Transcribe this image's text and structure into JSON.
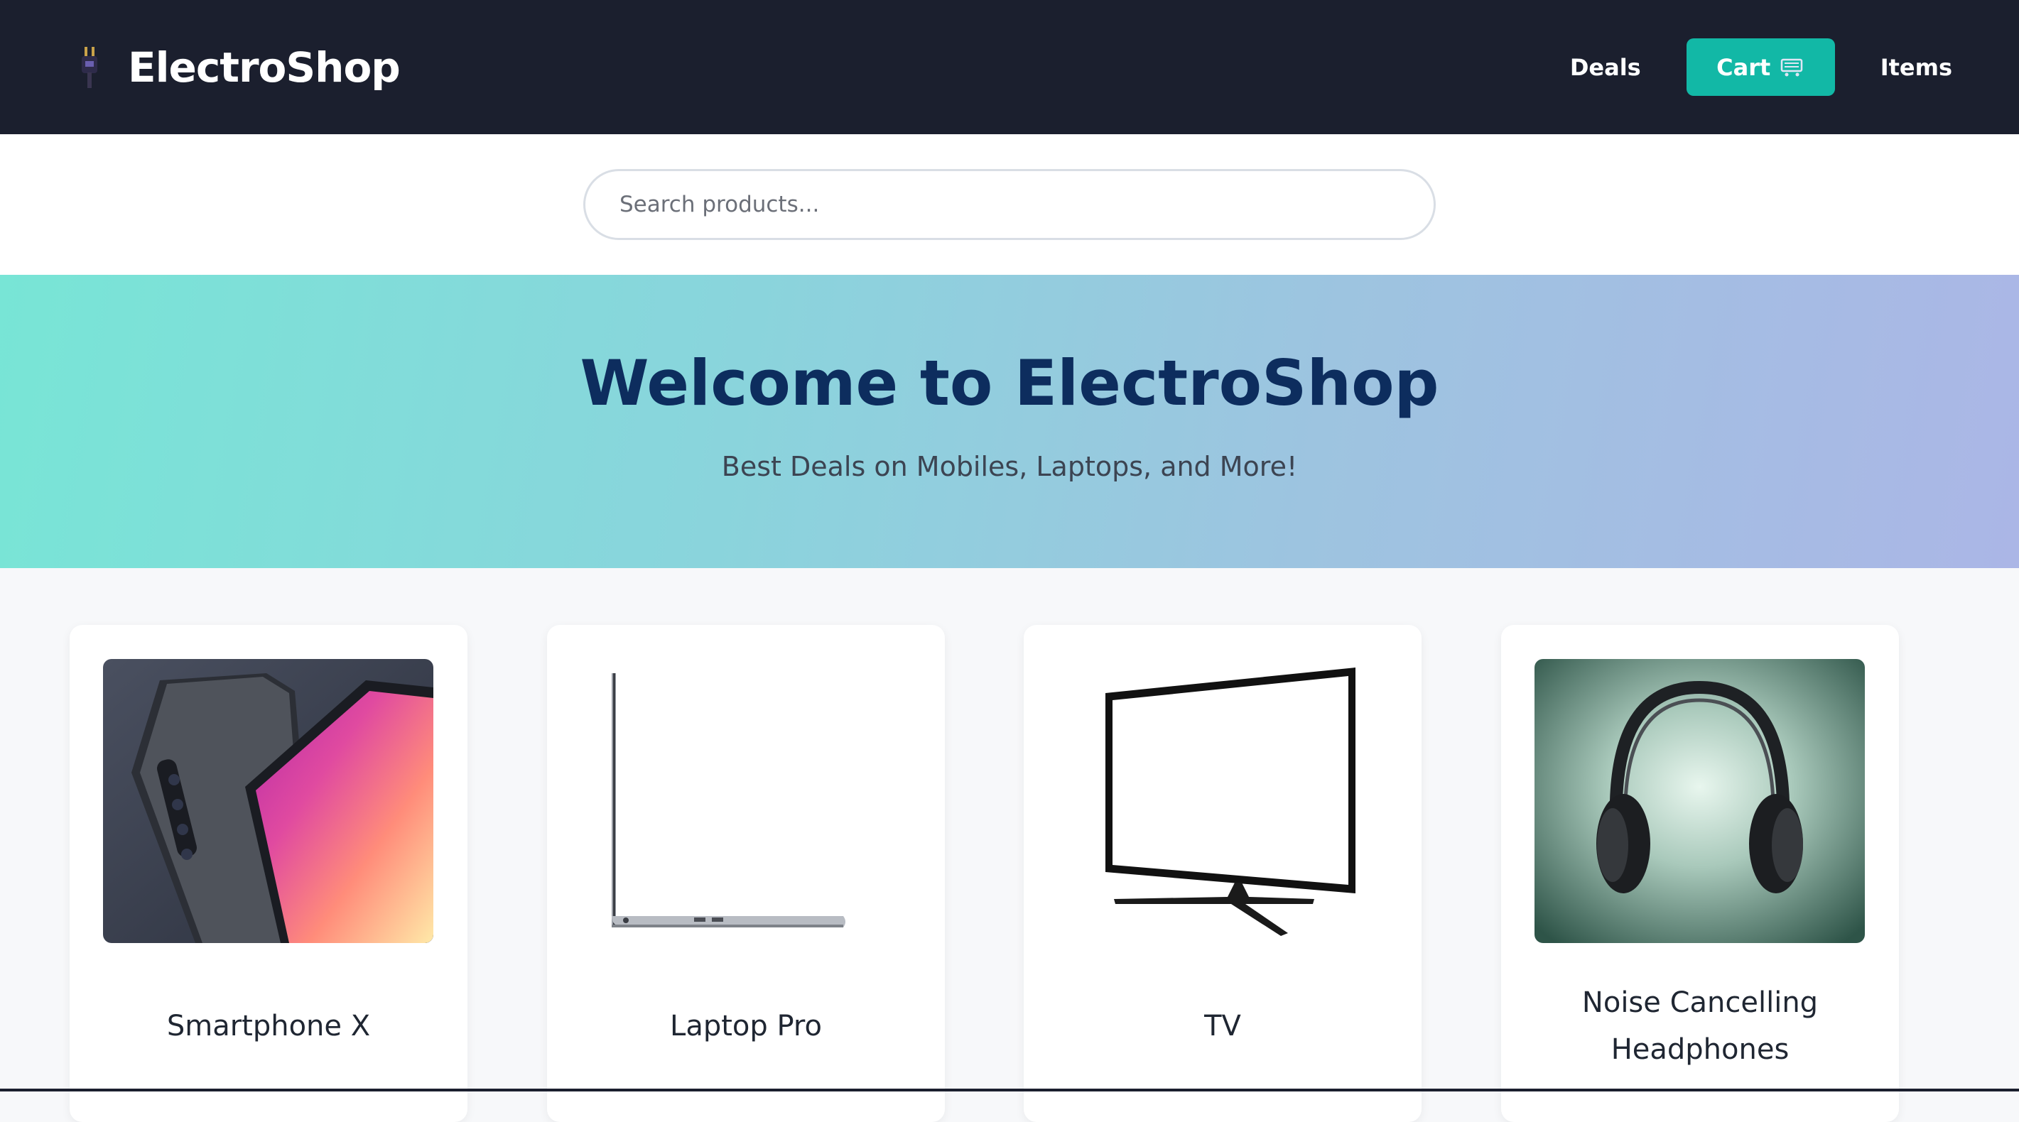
{
  "header": {
    "brand": "ElectroShop",
    "nav": {
      "deals": "Deals",
      "cart": "Cart",
      "items": "Items"
    },
    "colors": {
      "bar": "#1b1f2e",
      "cart_button": "#12b8a6"
    },
    "icons": {
      "logo": "plug-icon",
      "cart": "cart-icon"
    }
  },
  "search": {
    "placeholder": "Search products...",
    "value": ""
  },
  "hero": {
    "title": "Welcome to ElectroShop",
    "subtitle": "Best Deals on Mobiles, Laptops, and More!",
    "title_color": "#0d2d5e"
  },
  "products": [
    {
      "name": "Smartphone X",
      "image": "smartphone-image"
    },
    {
      "name": "Laptop Pro",
      "image": "laptop-image"
    },
    {
      "name": "TV",
      "image": "tv-image"
    },
    {
      "name": "Noise Cancelling Headphones",
      "image": "headphones-image"
    }
  ]
}
